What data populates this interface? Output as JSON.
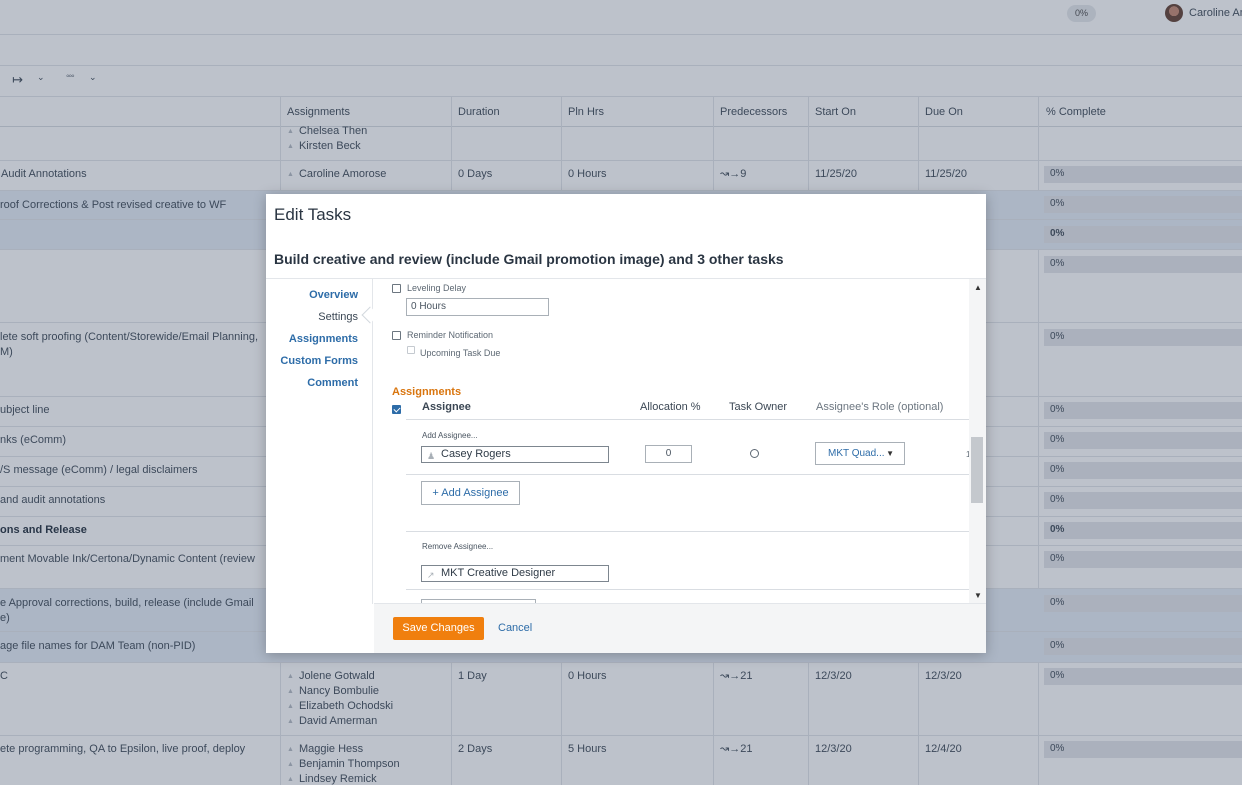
{
  "header": {
    "progress_pill": "0%",
    "user_name": "Caroline Am"
  },
  "toolbar": {
    "export_icon": "export-icon",
    "chevron_icon": "chevron-down-icon",
    "more_icon": "more-icon"
  },
  "grid": {
    "columns": [
      "Assignments",
      "Duration",
      "Pln Hrs",
      "Predecessors",
      "Start On",
      "Due On",
      "% Complete"
    ],
    "rows": [
      {
        "task": "",
        "assignees": [
          "Chelsea Then",
          "Kirsten Beck"
        ],
        "duration": "",
        "pln_hrs": "",
        "pred": "",
        "start": "",
        "due": "",
        "pct": ""
      },
      {
        "task": "Audit Annotations",
        "assignees": [
          "Caroline Amorose"
        ],
        "duration": "0 Days",
        "pln_hrs": "0 Hours",
        "pred": "9",
        "start": "11/25/20",
        "due": "11/25/20",
        "pct": "0%"
      },
      {
        "task": "roof Corrections & Post revised creative to WF",
        "assignees": [],
        "duration": "",
        "pln_hrs": "",
        "pred": "",
        "start": "",
        "due": "",
        "pct": "0%"
      },
      {
        "task": "",
        "assignees": [],
        "duration": "",
        "pln_hrs": "",
        "pred": "",
        "start": "",
        "due": "",
        "pct": "0%"
      },
      {
        "task": "",
        "assignees": [],
        "duration": "",
        "pln_hrs": "",
        "pred": "",
        "start": "",
        "due": "",
        "pct": "0%"
      },
      {
        "task": "lete soft proofing (Content/Storewide/Email Planning,",
        "task2": "M)",
        "assignees": [],
        "duration": "",
        "pln_hrs": "",
        "pred": "",
        "start": "",
        "due": "",
        "pct": "0%"
      },
      {
        "task": "ubject line",
        "assignees": [],
        "duration": "",
        "pln_hrs": "",
        "pred": "",
        "start": "",
        "due": "",
        "pct": "0%"
      },
      {
        "task": "nks (eComm)",
        "assignees": [],
        "duration": "",
        "pln_hrs": "",
        "pred": "",
        "start": "",
        "due": "",
        "pct": "0%"
      },
      {
        "task": "/S message (eComm) / legal disclaimers",
        "assignees": [],
        "duration": "",
        "pln_hrs": "",
        "pred": "",
        "start": "",
        "due": "",
        "pct": "0%"
      },
      {
        "task": "and audit annotations",
        "assignees": [],
        "duration": "",
        "pln_hrs": "",
        "pred": "",
        "start": "",
        "due": "",
        "pct": "0%"
      },
      {
        "task": "ons and Release",
        "assignees": [],
        "duration": "",
        "pln_hrs": "",
        "pred": "",
        "start": "",
        "due": "",
        "pct": "0%"
      },
      {
        "task": "ment Movable Ink/Certona/Dynamic Content (review",
        "assignees": [],
        "duration": "",
        "pln_hrs": "",
        "pred": "",
        "start": "",
        "due": "",
        "pct": "0%"
      },
      {
        "task": "e Approval corrections, build, release (include Gmail",
        "task2": "e)",
        "assignees": [],
        "duration": "",
        "pln_hrs": "",
        "pred": "",
        "start": "",
        "due": "",
        "pct": "0%"
      },
      {
        "task": "age file names for DAM Team (non-PID)",
        "assignees": [],
        "duration": "",
        "pln_hrs": "",
        "pred": "",
        "start": "",
        "due": "",
        "pct": "0%"
      },
      {
        "task": "C",
        "assignees": [
          "Jolene Gotwald",
          "Nancy Bombulie",
          "Elizabeth Ochodski",
          "David Amerman"
        ],
        "duration": "1 Day",
        "pln_hrs": "0 Hours",
        "pred": "21",
        "start": "12/3/20",
        "due": "12/3/20",
        "pct": "0%"
      },
      {
        "task": "ete programming, QA to Epsilon, live proof, deploy",
        "assignees": [
          "Maggie Hess",
          "Benjamin Thompson",
          "Lindsey Remick"
        ],
        "duration": "2 Days",
        "pln_hrs": "5 Hours",
        "pred": "21",
        "start": "12/3/20",
        "due": "12/4/20",
        "pct": "0%"
      }
    ]
  },
  "modal": {
    "title": "Edit Tasks",
    "subtitle": "Build creative and review (include Gmail promotion image) and 3 other tasks",
    "nav": [
      "Overview",
      "Settings",
      "Assignments",
      "Custom Forms",
      "Comment"
    ],
    "leveling_delay_label": "Leveling Delay",
    "leveling_delay_value": "0 Hours",
    "reminder_label": "Reminder Notification",
    "upcoming_label": "Upcoming Task Due",
    "assignments_title": "Assignments",
    "col_assignee": "Assignee",
    "col_allocation": "Allocation %",
    "col_owner": "Task Owner",
    "col_role": "Assignee's Role (optional)",
    "add_assignee_label": "Add Assignee...",
    "assignee_value": "Casey Rogers",
    "allocation_value": "0",
    "role_value": "MKT Quad...",
    "add_assignee_button": "+ Add Assignee",
    "remove_assignee_label": "Remove Assignee...",
    "remove_value": "MKT Creative Designer",
    "save_button": "Save Changes",
    "cancel_button": "Cancel"
  }
}
